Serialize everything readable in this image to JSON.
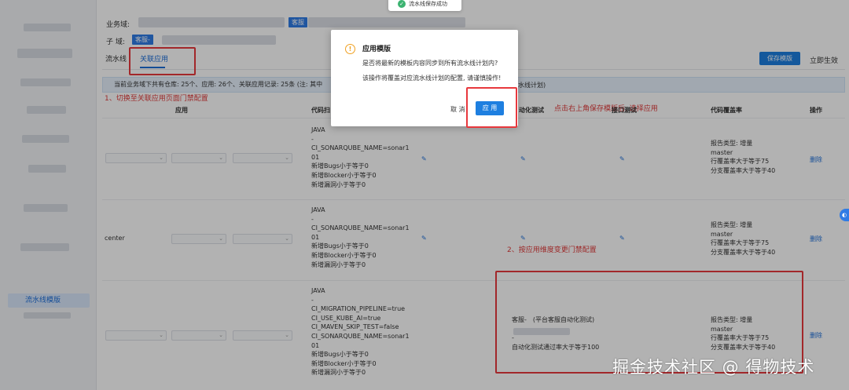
{
  "toast": {
    "text": "流水线保存成功"
  },
  "sidebar": {
    "active_item": "流水线模版"
  },
  "header": {
    "business_domain_label": "业务域:",
    "business_domain_tag": "客服",
    "sub_domain_label": "子  域:",
    "sub_domain_tag": "客服-"
  },
  "tabs": [
    {
      "label": "流水线"
    },
    {
      "label": "关联应用"
    }
  ],
  "toolbar": {
    "save_template": "保存模版",
    "apply_now": "立即生效"
  },
  "info_bar": {
    "text_left": "当前业务域下共有仓库: 25个、应用: 26个、关联应用记录: 25条 (注: 其中",
    "text_right": "水线计划)"
  },
  "annotations": {
    "a1": "1、切换至关联应用页面门禁配置",
    "a2": "点击右上角保存模版后, 选择应用",
    "a3": "2、按应用维度变更门禁配置"
  },
  "table": {
    "columns": [
      "应用",
      "代码扫",
      "动化测试",
      "接口测试",
      "代码覆盖率",
      "操作"
    ],
    "rows": [
      {
        "scan": "JAVA\n-\nCI_SONARQUBE_NAME=sonar1\n01\n新增Bugs小于等于0\n新增Blocker小于等于0\n新增漏洞小于等于0",
        "coverage": "报告类型: 增量\nmaster\n行覆盖率大于等于75\n分支覆盖率大于等于40",
        "action": "删除"
      },
      {
        "app": "center",
        "scan": "JAVA\n-\nCI_SONARQUBE_NAME=sonar1\n01\n新增Bugs小于等于0\n新增Blocker小于等于0\n新增漏洞小于等于0",
        "coverage": "报告类型: 增量\nmaster\n行覆盖率大于等于75\n分支覆盖率大于等于40",
        "action": "删除"
      },
      {
        "scan": "JAVA\n-\nCI_MIGRATION_PIPELINE=true\nCI_USE_KUBE_AI=true\nCI_MAVEN_SKIP_TEST=false\nCI_SONARQUBE_NAME=sonar1\n01\n新增Bugs小于等于0\n新增Blocker小于等于0\n新增漏洞小于等于0",
        "autotest": "客服-　(平台客服自动化测试)\n\n-\n自动化测试通过率大于等于100",
        "coverage": "报告类型: 增量\nmaster\n行覆盖率大于等于75\n分支覆盖率大于等于40",
        "action": "删除"
      }
    ]
  },
  "modal": {
    "title": "应用模版",
    "line1": "是否将最新的模板内容同步到所有流水线计划内?",
    "line2": "该操作将覆盖对应流水线计划的配置, 请谨慎操作!",
    "cancel": "取 消",
    "confirm": "应 用"
  },
  "watermark": "掘金技术社区 @ 得物技术",
  "colors": {
    "primary": "#1e7fe0",
    "annotation": "#e8383d",
    "warning": "#f0a020",
    "success": "#3cb371"
  }
}
